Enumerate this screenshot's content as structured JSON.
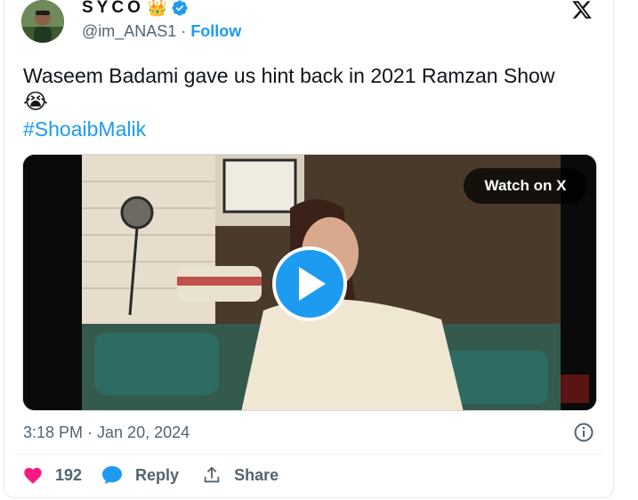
{
  "author": {
    "display_name": "SYCO",
    "crown_emoji": "👑",
    "handle": "@im_ANAS1",
    "separator": "·",
    "follow_label": "Follow"
  },
  "tweet": {
    "text": "Waseem Badami gave us hint back in 2021 Ramzan Show",
    "emoji": "😭",
    "hashtag": "#ShoaibMalik"
  },
  "media": {
    "watch_label": "Watch on X",
    "watermark": "express"
  },
  "meta": {
    "timestamp": "3:18 PM · Jan 20, 2024"
  },
  "actions": {
    "like_count": "192",
    "reply_label": "Reply",
    "share_label": "Share"
  },
  "colors": {
    "accent": "#1d9bf0",
    "like": "#f91880",
    "text": "#0f1419",
    "muted": "#536471"
  },
  "icons": [
    "verified-badge-icon",
    "x-logo-icon",
    "play-icon",
    "info-icon",
    "heart-icon",
    "reply-bubble-icon",
    "share-icon"
  ]
}
